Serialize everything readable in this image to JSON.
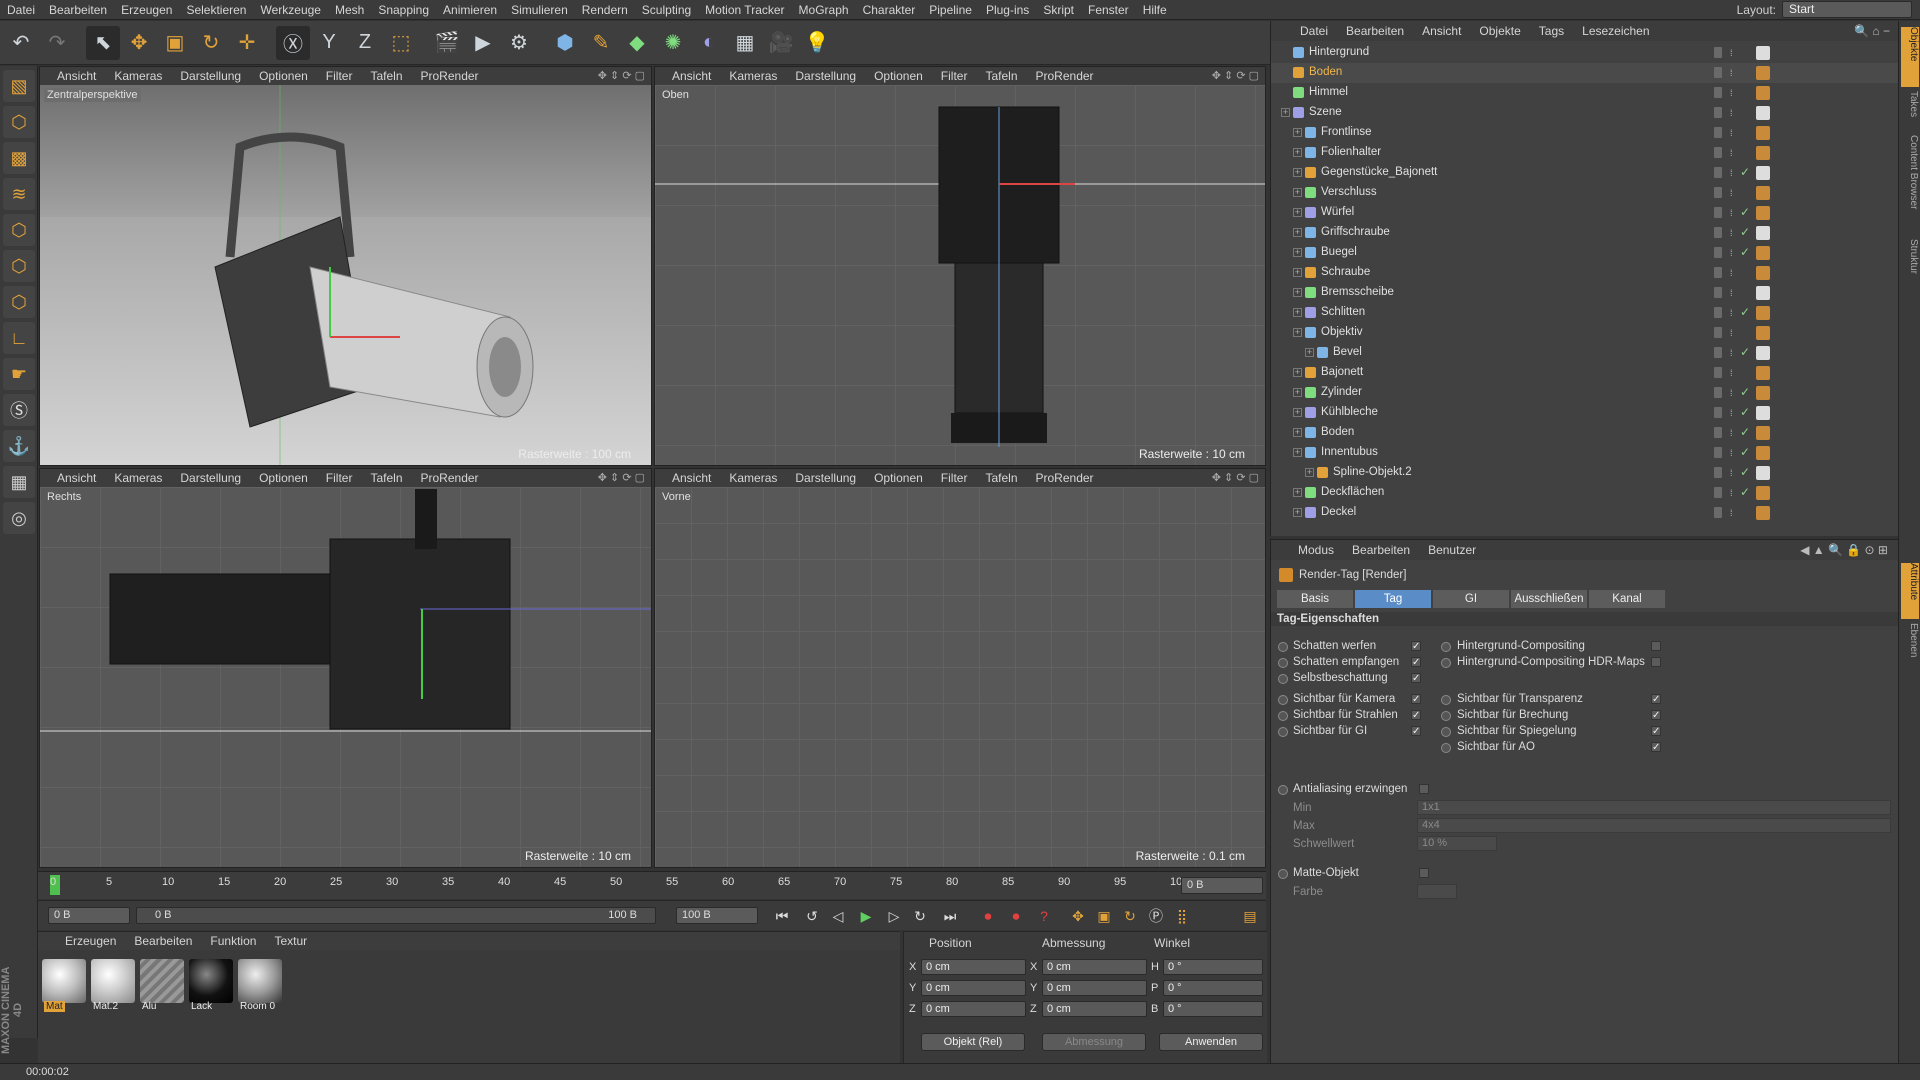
{
  "menu": [
    "Datei",
    "Bearbeiten",
    "Erzeugen",
    "Selektieren",
    "Werkzeuge",
    "Mesh",
    "Snapping",
    "Animieren",
    "Simulieren",
    "Rendern",
    "Sculpting",
    "Motion Tracker",
    "MoGraph",
    "Charakter",
    "Pipeline",
    "Plug-ins",
    "Skript",
    "Fenster",
    "Hilfe"
  ],
  "layout": {
    "label": "Layout:",
    "value": "Start"
  },
  "viewport_menu": [
    "Ansicht",
    "Kameras",
    "Darstellung",
    "Optionen",
    "Filter",
    "Tafeln",
    "ProRender"
  ],
  "viewports": {
    "persp": {
      "name": "Zentralperspektive",
      "raster": "Rasterweite : 100 cm"
    },
    "top": {
      "name": "Oben",
      "raster": "Rasterweite : 10 cm"
    },
    "right": {
      "name": "Rechts",
      "raster": "Rasterweite : 10 cm"
    },
    "front": {
      "name": "Vorne",
      "raster": "Rasterweite : 0.1 cm"
    }
  },
  "timeline": {
    "ticks": [
      "0",
      "5",
      "10",
      "15",
      "20",
      "25",
      "30",
      "35",
      "40",
      "45",
      "50",
      "55",
      "60",
      "65",
      "70",
      "75",
      "80",
      "85",
      "90",
      "95",
      "100"
    ],
    "current_frame": "0 B",
    "start": "0 B",
    "range_start": "0 B",
    "range_end": "100 B",
    "end": "100 B"
  },
  "materials": {
    "menu": [
      "Erzeugen",
      "Bearbeiten",
      "Funktion",
      "Textur"
    ],
    "items": [
      "Mat",
      "Mat.2",
      "Alu",
      "Lack",
      "Room 0"
    ]
  },
  "coords": {
    "headers": [
      "Position",
      "Abmessung",
      "Winkel"
    ],
    "rows": [
      {
        "axis": "X",
        "pos": "0 cm",
        "axis2": "X",
        "size": "0 cm",
        "axis3": "H",
        "rot": "0 °"
      },
      {
        "axis": "Y",
        "pos": "0 cm",
        "axis2": "Y",
        "size": "0 cm",
        "axis3": "P",
        "rot": "0 °"
      },
      {
        "axis": "Z",
        "pos": "0 cm",
        "axis2": "Z",
        "size": "0 cm",
        "axis3": "B",
        "rot": "0 °"
      }
    ],
    "mode": "Objekt (Rel)",
    "size_mode": "Abmessung",
    "apply": "Anwenden"
  },
  "status": "00:00:02",
  "maxon": "MAXON CINEMA 4D",
  "objmgr": {
    "menu": [
      "Datei",
      "Bearbeiten",
      "Ansicht",
      "Objekte",
      "Tags",
      "Lesezeichen"
    ],
    "objects": [
      {
        "name": "Hintergrund",
        "indent": 0,
        "selected": false,
        "check": false
      },
      {
        "name": "Boden",
        "indent": 0,
        "selected": true,
        "check": false
      },
      {
        "name": "Himmel",
        "indent": 0,
        "selected": false,
        "check": false
      },
      {
        "name": "Szene",
        "indent": 0,
        "selected": false,
        "check": false
      },
      {
        "name": "Frontlinse",
        "indent": 1,
        "selected": false,
        "check": false
      },
      {
        "name": "Folienhalter",
        "indent": 1,
        "selected": false,
        "check": false
      },
      {
        "name": "Gegenstücke_Bajonett",
        "indent": 1,
        "selected": false,
        "check": true
      },
      {
        "name": "Verschluss",
        "indent": 1,
        "selected": false,
        "check": false
      },
      {
        "name": "Würfel",
        "indent": 1,
        "selected": false,
        "check": true
      },
      {
        "name": "Griffschraube",
        "indent": 1,
        "selected": false,
        "check": true
      },
      {
        "name": "Buegel",
        "indent": 1,
        "selected": false,
        "check": true
      },
      {
        "name": "Schraube",
        "indent": 1,
        "selected": false,
        "check": false
      },
      {
        "name": "Bremsscheibe",
        "indent": 1,
        "selected": false,
        "check": false
      },
      {
        "name": "Schlitten",
        "indent": 1,
        "selected": false,
        "check": true
      },
      {
        "name": "Objektiv",
        "indent": 1,
        "selected": false,
        "check": false
      },
      {
        "name": "Bevel",
        "indent": 2,
        "selected": false,
        "check": true
      },
      {
        "name": "Bajonett",
        "indent": 1,
        "selected": false,
        "check": false
      },
      {
        "name": "Zylinder",
        "indent": 1,
        "selected": false,
        "check": true
      },
      {
        "name": "Kühlbleche",
        "indent": 1,
        "selected": false,
        "check": true
      },
      {
        "name": "Boden",
        "indent": 1,
        "selected": false,
        "check": true
      },
      {
        "name": "Innentubus",
        "indent": 1,
        "selected": false,
        "check": true
      },
      {
        "name": "Spline-Objekt.2",
        "indent": 2,
        "selected": false,
        "check": true
      },
      {
        "name": "Deckflächen",
        "indent": 1,
        "selected": false,
        "check": true
      },
      {
        "name": "Deckel",
        "indent": 1,
        "selected": false,
        "check": false
      }
    ]
  },
  "attr": {
    "menu": [
      "Modus",
      "Bearbeiten",
      "Benutzer"
    ],
    "title": "Render-Tag [Render]",
    "tabs": [
      "Basis",
      "Tag",
      "GI",
      "Ausschließen",
      "Kanal"
    ],
    "active_tab": "Tag",
    "section": "Tag-Eigenschaften",
    "left_props": [
      {
        "label": "Schatten werfen",
        "checked": true
      },
      {
        "label": "Schatten empfangen",
        "checked": true
      },
      {
        "label": "Selbstbeschattung",
        "checked": true
      },
      {
        "label": "Sichtbar für Kamera",
        "checked": true
      },
      {
        "label": "Sichtbar für Strahlen",
        "checked": true
      },
      {
        "label": "Sichtbar für GI",
        "checked": true
      }
    ],
    "right_props": [
      {
        "label": "Hintergrund-Compositing",
        "checked": false
      },
      {
        "label": "Hintergrund-Compositing HDR-Maps",
        "checked": false
      },
      {
        "label": "Sichtbar für Transparenz",
        "checked": true
      },
      {
        "label": "Sichtbar für Brechung",
        "checked": true
      },
      {
        "label": "Sichtbar für Spiegelung",
        "checked": true
      },
      {
        "label": "Sichtbar für AO",
        "checked": true
      }
    ],
    "antialias": "Antialiasing erzwingen",
    "min_label": "Min",
    "min_value": "1x1",
    "max_label": "Max",
    "max_value": "4x4",
    "threshold_label": "Schwellwert",
    "threshold_value": "10 %",
    "matte": "Matte-Objekt",
    "color_label": "Farbe"
  },
  "right_tabs": [
    "Objekte",
    "Takes",
    "Content Browser",
    "Struktur",
    "Attribute",
    "Ebenen"
  ]
}
